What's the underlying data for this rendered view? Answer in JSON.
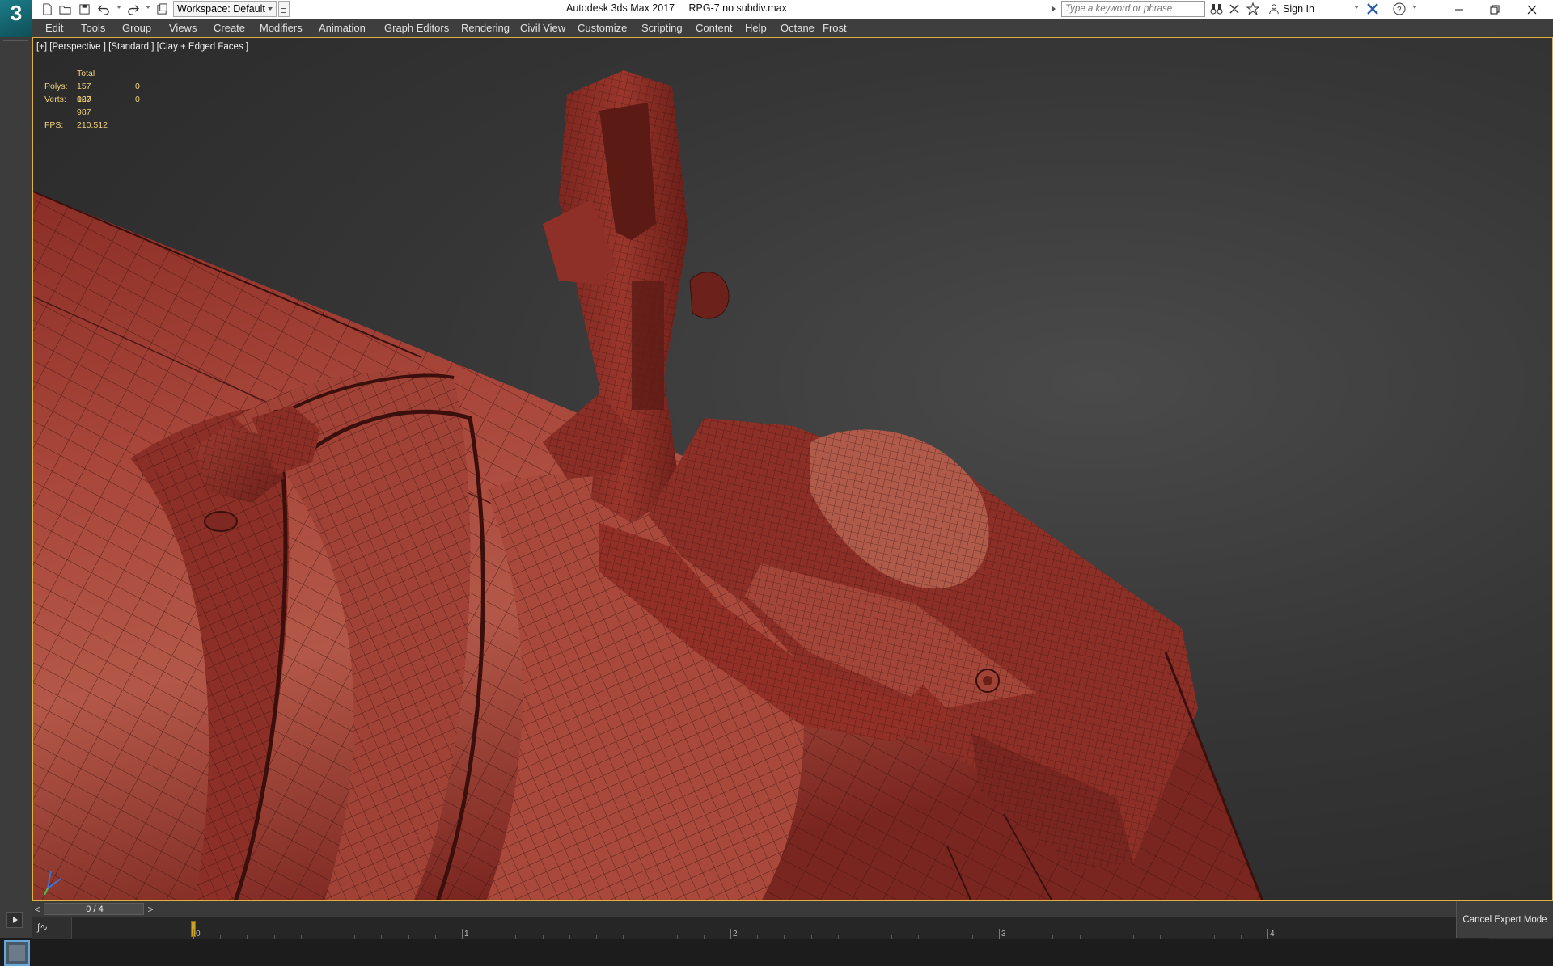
{
  "app": {
    "title": "Autodesk 3ds Max 2017     RPG-7 no subdiv.max",
    "logo_text": "3"
  },
  "toolbar": {
    "workspace_label": "Workspace: Default",
    "search_placeholder": "Type a keyword or phrase",
    "sign_in_label": "Sign In"
  },
  "menu": {
    "items": [
      "Edit",
      "Tools",
      "Group",
      "Views",
      "Create",
      "Modifiers",
      "Animation",
      "Graph Editors",
      "Rendering",
      "Civil View",
      "Customize",
      "Scripting",
      "Content",
      "Help",
      "Octane",
      "Frost"
    ]
  },
  "viewport": {
    "label": "[+] [Perspective ] [Standard ] [Clay + Edged Faces ]",
    "stats": {
      "total_label": "Total",
      "polys_label": "Polys:",
      "polys_total": "157 087",
      "polys_selected": "0",
      "verts_label": "Verts:",
      "verts_total": "120 987",
      "verts_selected": "0",
      "fps_label": "FPS:",
      "fps_value": "210.512"
    },
    "model_color": "#9e3a30",
    "wire_color": "#3a0f0c"
  },
  "timeline": {
    "frame_label": "0 / 4",
    "prev_label": "<",
    "next_label": ">",
    "ticks": [
      "0",
      "1",
      "2",
      "3",
      "4"
    ],
    "current_frame": 0,
    "total_frames": 4
  },
  "status": {
    "cancel_expert_label": "Cancel Expert Mode"
  }
}
